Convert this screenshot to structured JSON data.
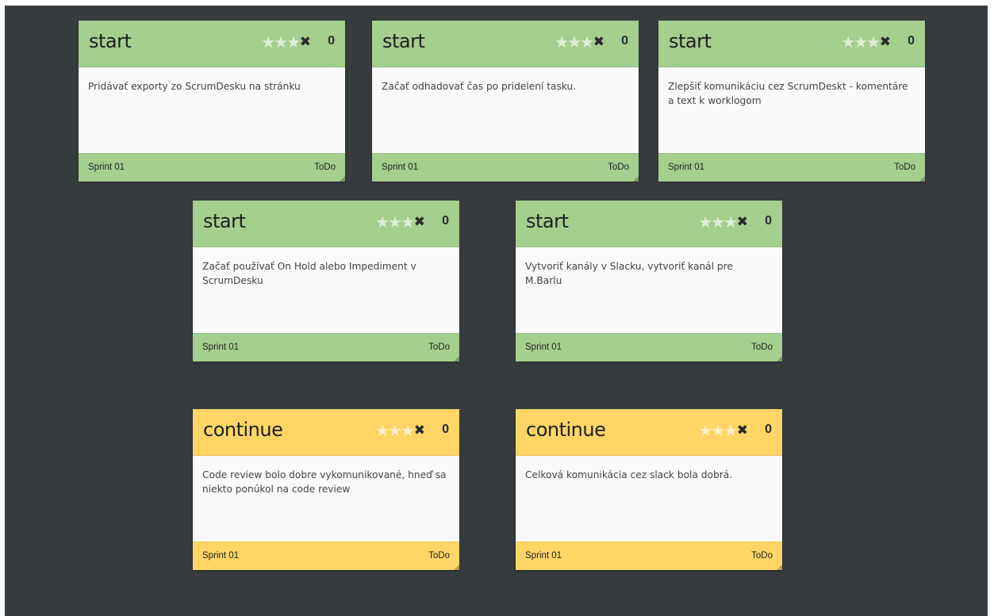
{
  "colors": {
    "board_bg": "#363b3d",
    "start": "#a4cf8f",
    "continue": "#ffd566",
    "card_body": "#fafafa"
  },
  "cards": [
    {
      "category": "start",
      "title": "start",
      "stars_icon": "★★★",
      "rating": 0,
      "close_icon": "✖",
      "votes": "0",
      "text": "Pridávať exporty zo ScrumDesku na stránku",
      "sprint": "Sprint 01",
      "status": "ToDo"
    },
    {
      "category": "start",
      "title": "start",
      "stars_icon": "★★★",
      "rating": 0,
      "close_icon": "✖",
      "votes": "0",
      "text": "Začať odhadovať čas po pridelení tasku.",
      "sprint": "Sprint 01",
      "status": "ToDo"
    },
    {
      "category": "start",
      "title": "start",
      "stars_icon": "★★★",
      "rating": 0,
      "close_icon": "✖",
      "votes": "0",
      "text": "Zlepšiť komunikáciu cez ScrumDeskt - komentáre a text k worklogom",
      "sprint": "Sprint 01",
      "status": "ToDo"
    },
    {
      "category": "start",
      "title": "start",
      "stars_icon": "★★★",
      "rating": 0,
      "close_icon": "✖",
      "votes": "0",
      "text": "Začať používať On Hold alebo Impediment v ScrumDesku",
      "sprint": "Sprint 01",
      "status": "ToDo"
    },
    {
      "category": "start",
      "title": "start",
      "stars_icon": "★★★",
      "rating": 0,
      "close_icon": "✖",
      "votes": "0",
      "text": "Vytvoriť kanály v Slacku, vytvoriť kanál pre M.Barlu",
      "sprint": "Sprint 01",
      "status": "ToDo"
    },
    {
      "category": "continue",
      "title": "continue",
      "stars_icon": "★★★",
      "rating": 0,
      "close_icon": "✖",
      "votes": "0",
      "text": "Code review bolo dobre vykomunikované, hneď sa niekto ponúkol na code review",
      "sprint": "Sprint 01",
      "status": "ToDo"
    },
    {
      "category": "continue",
      "title": "continue",
      "stars_icon": "★★★",
      "rating": 0,
      "close_icon": "✖",
      "votes": "0",
      "text": "Celková komunikácia cez slack bola dobrá.",
      "sprint": "Sprint 01",
      "status": "ToDo"
    }
  ]
}
